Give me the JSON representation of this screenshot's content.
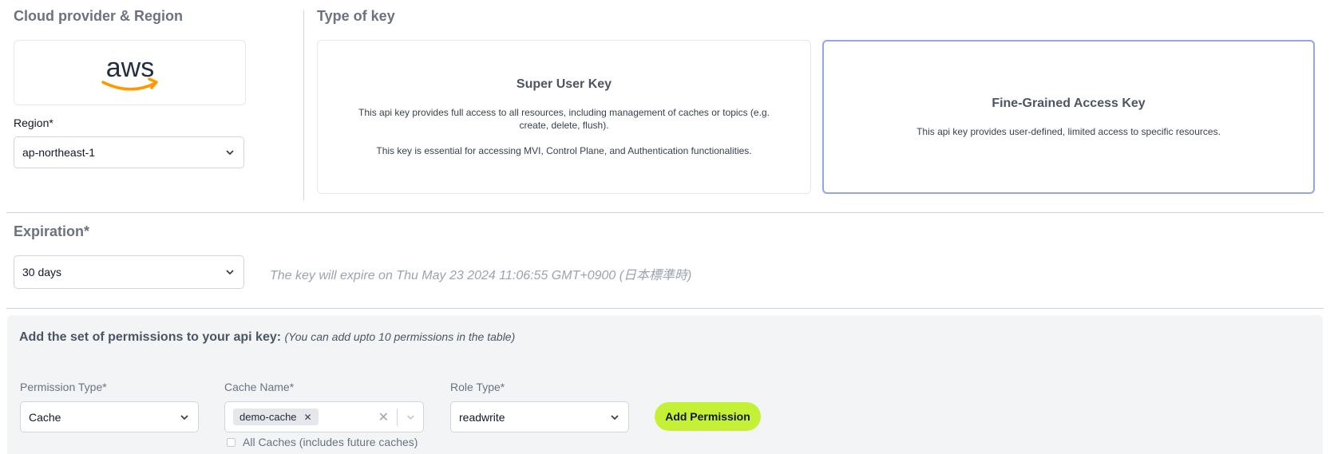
{
  "provider": {
    "title": "Cloud provider & Region",
    "logo_text": "aws",
    "region_label": "Region*",
    "region_value": "ap-northeast-1"
  },
  "key_type": {
    "title": "Type of key",
    "super_user": {
      "title": "Super User Key",
      "desc1": "This api key provides full access to all resources, including management of caches or topics (e.g.",
      "desc2": "create, delete, flush).",
      "desc3": "This key is essential for accessing MVI, Control Plane, and Authentication functionalities."
    },
    "fine_grained": {
      "title": "Fine-Grained Access Key",
      "desc": "This api key provides user-defined, limited access to specific resources.",
      "selected": true
    }
  },
  "expiration": {
    "title": "Expiration*",
    "value": "30 days",
    "note": "The key will expire on Thu May 23 2024 11:06:55 GMT+0900 (日本標準時)"
  },
  "permissions": {
    "heading": "Add the set of permissions to your api key:",
    "subheading": "(You can add upto 10 permissions in the table)",
    "permission_type_label": "Permission Type*",
    "permission_type_value": "Cache",
    "cache_name_label": "Cache Name*",
    "cache_tags": [
      "demo-cache"
    ],
    "all_caches_label": "All Caches (includes future caches)",
    "role_type_label": "Role Type*",
    "role_type_value": "readwrite",
    "add_button": "Add Permission"
  },
  "colors": {
    "accent_button": "#c4f135",
    "selected_border": "#93a4f0",
    "aws_orange": "#ff9900"
  }
}
